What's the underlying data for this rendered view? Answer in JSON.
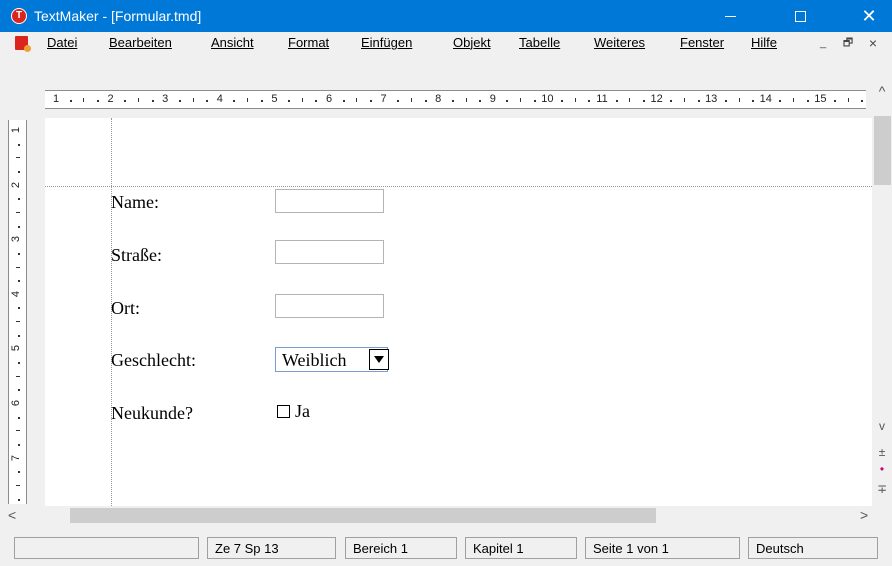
{
  "window": {
    "title": "TextMaker - [Formular.tmd]",
    "app_icon_letter": "T",
    "minimize_glyph": "",
    "close_glyph": "✕"
  },
  "menu": {
    "items": [
      "Datei",
      "Bearbeiten",
      "Ansicht",
      "Format",
      "Einfügen",
      "Objekt",
      "Tabelle",
      "Weiteres",
      "Fenster",
      "Hilfe"
    ],
    "mdi_minimize": "_",
    "mdi_restore": "🗗",
    "mdi_close": "×"
  },
  "ruler": {
    "horizontal": [
      "1",
      "2",
      "3",
      "4",
      "5",
      "6",
      "7",
      "8",
      "9",
      "10",
      "11",
      "12",
      "13",
      "14",
      "15"
    ],
    "vertical": [
      "1",
      "2",
      "3",
      "4",
      "5",
      "6",
      "7"
    ]
  },
  "form": {
    "name_label": "Name:",
    "street_label": "Straße:",
    "city_label": "Ort:",
    "gender_label": "Geschlecht:",
    "gender_value": "Weiblich",
    "new_customer_label": "Neukunde?",
    "checkbox_label": "Ja",
    "checkbox_checked": false
  },
  "scrollbar": {
    "up": "^",
    "down": "v",
    "prev_page": "±",
    "browse": "•",
    "next_page": "∓",
    "left": "<",
    "right": ">"
  },
  "status": {
    "blank": "",
    "position": "Ze 7 Sp 13",
    "section": "Bereich 1",
    "chapter": "Kapitel 1",
    "page": "Seite 1 von 1",
    "language": "Deutsch"
  },
  "colors": {
    "titlebar": "#0078d7",
    "app_icon": "#d9251c",
    "background": "#f0f0f0"
  },
  "icons": {
    "app": "textmaker-logo-icon",
    "document": "document-icon",
    "dropdown": "chevron-down-icon",
    "checkbox": "checkbox-icon"
  }
}
